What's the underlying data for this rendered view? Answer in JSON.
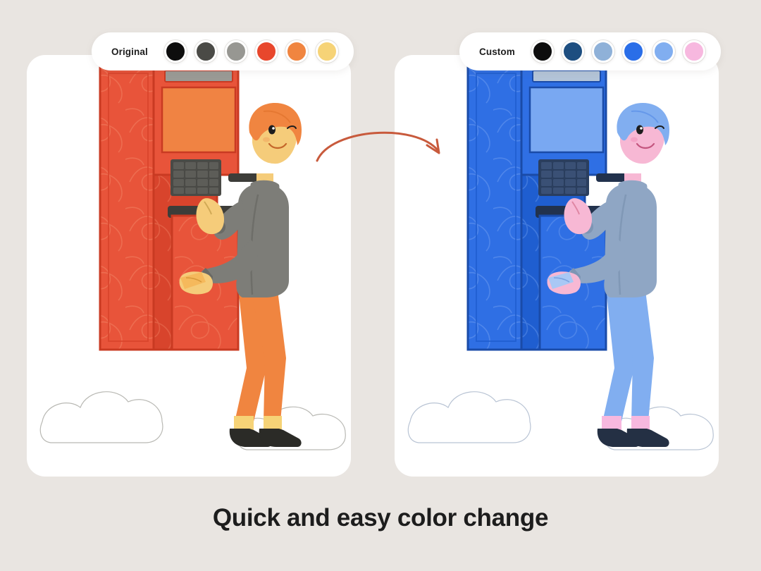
{
  "page": {
    "background_color": "#e9e5e1",
    "caption": "Quick and easy color change"
  },
  "palettes": [
    {
      "name": "original",
      "label": "Original",
      "swatches": [
        {
          "name": "swatch-black",
          "color": "#0d0d0d"
        },
        {
          "name": "swatch-dark-gray",
          "color": "#4a4a46"
        },
        {
          "name": "swatch-gray",
          "color": "#979792"
        },
        {
          "name": "swatch-red-orange",
          "color": "#e8472c"
        },
        {
          "name": "swatch-orange",
          "color": "#f08540"
        },
        {
          "name": "swatch-yellow",
          "color": "#f6d377"
        }
      ]
    },
    {
      "name": "custom",
      "label": "Custom",
      "swatches": [
        {
          "name": "swatch-black",
          "color": "#0d0d0d"
        },
        {
          "name": "swatch-navy",
          "color": "#1d4e80"
        },
        {
          "name": "swatch-steel-blue",
          "color": "#8fb1d8"
        },
        {
          "name": "swatch-bright-blue",
          "color": "#2a6ee8"
        },
        {
          "name": "swatch-light-blue",
          "color": "#81aef0"
        },
        {
          "name": "swatch-pink",
          "color": "#f7b8df"
        }
      ]
    }
  ],
  "cards": [
    {
      "name": "card-original",
      "variant": "original",
      "illustration": "atm-person-orange",
      "colors": {
        "machine_body": "#e8543a",
        "machine_body_dark": "#d8442c",
        "machine_side": "#e65f41",
        "machine_edge": "#c93a22",
        "screen": "#f08343",
        "screen_header": "#9a9a95",
        "keypad": "#4a4a46",
        "keypad_key": "#5d5d58",
        "slot": "#3d3d39",
        "shirt": "#7d7d78",
        "shirt_dark": "#6a6a65",
        "pants": "#f08540",
        "skin": "#f5cc7a",
        "hair": "#f08540",
        "sock": "#f6d377",
        "shoe": "#2b2b27",
        "cloud_fill": "#ffffff",
        "cloud_stroke": "#b9b9b4",
        "pattern_line": "#f08a6a",
        "card_money": "#f5b95c"
      }
    },
    {
      "name": "card-custom",
      "variant": "custom",
      "illustration": "atm-person-blue",
      "colors": {
        "machine_body": "#2f6fe4",
        "machine_body_dark": "#1f5ed0",
        "machine_side": "#3f7ceb",
        "machine_edge": "#1a4ba8",
        "screen": "#79a8f2",
        "screen_header": "#b3c4d8",
        "keypad": "#2a3e5e",
        "keypad_key": "#3a5075",
        "slot": "#22324d",
        "shirt": "#8fa6c4",
        "shirt_dark": "#7e95b4",
        "pants": "#81aef0",
        "skin": "#f7b8d4",
        "hair": "#81aef0",
        "sock": "#f7b8df",
        "shoe": "#243044",
        "cloud_fill": "#ffffff",
        "cloud_stroke": "#b9c4d4",
        "pattern_line": "#6d9cf0",
        "card_money": "#a9c8f5"
      }
    }
  ],
  "arrow": {
    "name": "transform-arrow",
    "color": "#c85a3c",
    "direction": "left-to-right"
  }
}
